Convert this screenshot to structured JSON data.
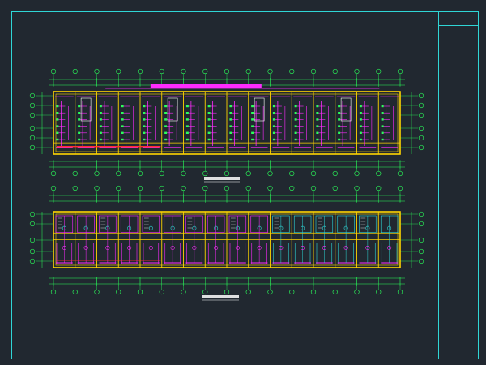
{
  "drawing": {
    "background": "#212830",
    "frame_color": "#2fd6d6",
    "colors": {
      "wall": "#ffd400",
      "grid": "#2aff5a",
      "wire": "#ff2bff",
      "equipment": "#2fd6d6",
      "dimension": "#2aff5a",
      "text": "#ffffff",
      "red": "#ff3030"
    },
    "plans": [
      {
        "id": "upper-plan",
        "rooms": 16,
        "caption": ""
      },
      {
        "id": "lower-plan",
        "rooms": 16,
        "caption": ""
      }
    ]
  }
}
